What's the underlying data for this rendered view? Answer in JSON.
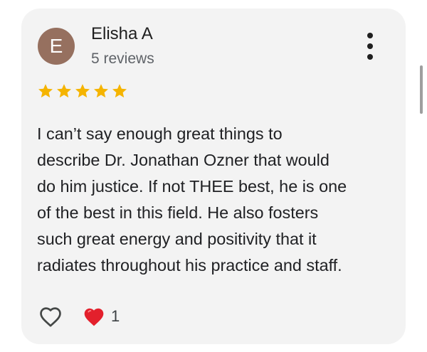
{
  "reviewer": {
    "initial": "E",
    "name": "Elisha A",
    "review_count": "5 reviews",
    "avatar_color": "#96705f"
  },
  "rating": {
    "stars": 5,
    "max": 5,
    "star_color": "#f5b400"
  },
  "review": {
    "lines": [
      "I can’t say enough great things to",
      "describe Dr. Jonathan Ozner that would",
      "do him justice. If not THEE best, he is one",
      "of the best in this field. He also fosters",
      "such great energy and positivity that it",
      "radiates throughout his practice and staff."
    ]
  },
  "actions": {
    "like_icon": "heart-outline-icon",
    "reaction_icon": "red-heart-icon",
    "reaction_count": "1",
    "menu_icon": "more-vert-icon"
  }
}
